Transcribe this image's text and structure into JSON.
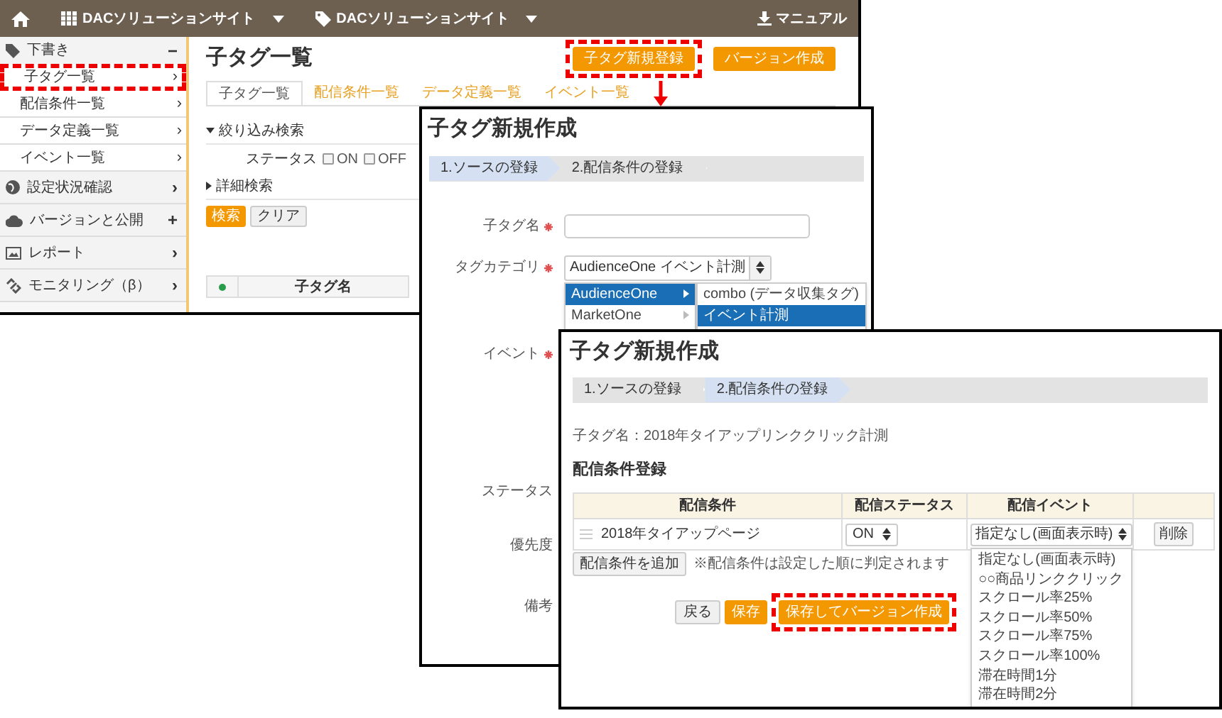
{
  "main_window": {
    "top_bar": {
      "sites": [
        {
          "label": "DACソリューションサイト"
        },
        {
          "label": "DACソリューションサイト"
        }
      ],
      "manual": "マニュアル"
    },
    "sidebar": {
      "sections": [
        {
          "label": "下書き",
          "marker": "−",
          "items": [
            {
              "label": "子タグ一覧",
              "marker": "›",
              "highlighted": true
            },
            {
              "label": "配信条件一覧",
              "marker": "›",
              "highlighted": false
            },
            {
              "label": "データ定義一覧",
              "marker": "›",
              "highlighted": false
            },
            {
              "label": "イベント一覧",
              "marker": "›",
              "highlighted": false
            }
          ]
        },
        {
          "label": "設定状況確認",
          "marker": "›"
        },
        {
          "label": "バージョンと公開",
          "marker": "+"
        },
        {
          "label": "レポート",
          "marker": "›"
        },
        {
          "label": "モニタリング（β）",
          "marker": "›"
        }
      ]
    },
    "page_title": "子タグ一覧",
    "header_buttons": [
      {
        "label": "子タグ新規登録",
        "highlighted": true
      },
      {
        "label": "バージョン作成"
      }
    ],
    "tabs": [
      {
        "label": "子タグ一覧",
        "selected": true
      },
      {
        "label": "配信条件一覧",
        "selected": false
      },
      {
        "label": "データ定義一覧",
        "selected": false
      },
      {
        "label": "イベント一覧",
        "selected": false
      }
    ],
    "filter": {
      "label": "絞り込み検索",
      "expanded": true,
      "status_label": "ステータス",
      "options": [
        {
          "label": "ON",
          "checked": false
        },
        {
          "label": "OFF",
          "checked": false
        }
      ]
    },
    "advanced_search": {
      "label": "詳細検索",
      "expanded": false
    },
    "buttons": [
      {
        "label": "検索",
        "kind": "primary"
      },
      {
        "label": "クリア",
        "kind": "default"
      }
    ],
    "table_columns": [
      "子タグ名"
    ]
  },
  "create_window": {
    "title": "子タグ新規作成",
    "steps": [
      {
        "label": "1.ソースの登録",
        "active": true
      },
      {
        "label": "2.配信条件の登録",
        "active": false
      }
    ],
    "fields": [
      {
        "label": "子タグ名",
        "required": true,
        "kind": "text"
      },
      {
        "label": "タグカテゴリ",
        "required": true,
        "kind": "select",
        "value": "AudienceOne イベント計測"
      },
      {
        "label": "イベント",
        "required": true,
        "kind": "label"
      },
      {
        "label": "ステータス",
        "required": false,
        "kind": "label"
      },
      {
        "label": "優先度",
        "required": false,
        "kind": "label"
      },
      {
        "label": "備考",
        "required": false,
        "kind": "label"
      }
    ],
    "category_menu": [
      [
        {
          "label": "AudienceOne",
          "selected": true
        },
        {
          "label": "MarketOne",
          "selected": false
        }
      ],
      [
        {
          "label": "combo (データ収集タグ)",
          "selected": false
        },
        {
          "label": "イベント計測",
          "selected": true
        }
      ]
    ]
  },
  "conditions_window": {
    "title": "子タグ新規作成",
    "steps": [
      {
        "label": "1.ソースの登録",
        "active": false
      },
      {
        "label": "2.配信条件の登録",
        "active": true
      }
    ],
    "tag_name": "子タグ名：2018年タイアップリンククリック計測",
    "section_title": "配信条件登録",
    "columns": [
      "配信条件",
      "配信ステータス",
      "配信イベント"
    ],
    "rows": [
      {
        "condition": "2018年タイアップページ",
        "status": "ON",
        "event": "指定なし(画面表示時)",
        "delete": "削除"
      }
    ],
    "add_button": "配信条件を追加",
    "note": "※配信条件は設定した順に判定されます",
    "buttons": [
      {
        "label": "戻る",
        "kind": "default"
      },
      {
        "label": "保存",
        "kind": "primary"
      },
      {
        "label": "保存してバージョン作成",
        "kind": "primary",
        "highlighted": true
      }
    ],
    "event_options": [
      "指定なし(画面表示時)",
      "○○商品リンククリック",
      "スクロール率25%",
      "スクロール率50%",
      "スクロール率75%",
      "スクロール率100%",
      "滞在時間1分",
      "滞在時間2分"
    ]
  }
}
